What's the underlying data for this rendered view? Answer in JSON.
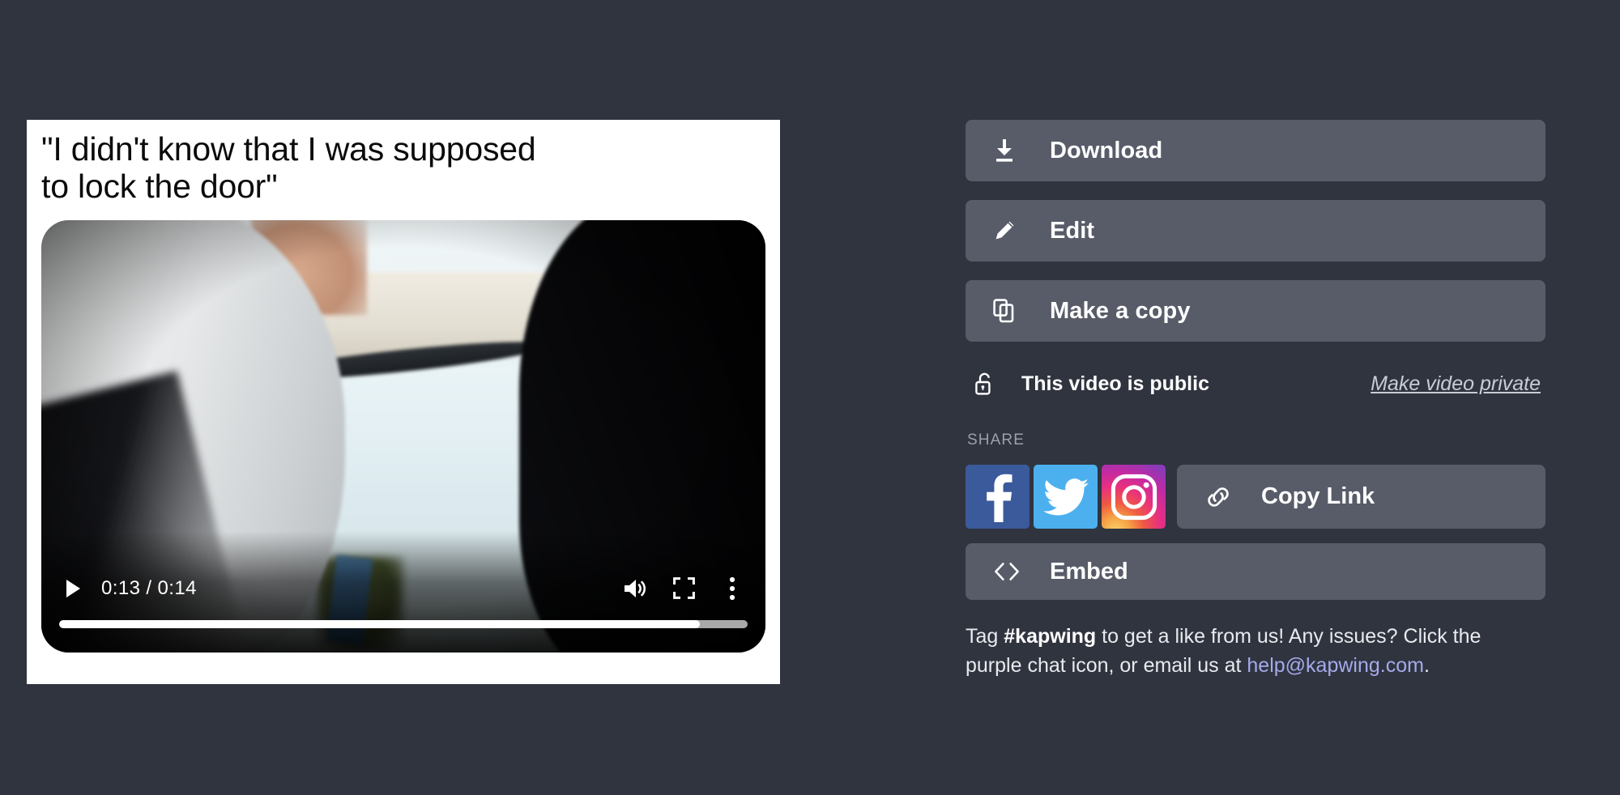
{
  "video": {
    "caption": "\"I didn't know that I was supposed\nto lock the door\"",
    "player": {
      "time_display": "0:13 / 0:14",
      "current_time": "0:13",
      "duration": "0:14",
      "progress_percent": 93,
      "state": "paused",
      "play_icon": "play-icon",
      "volume_icon": "volume-icon",
      "fullscreen_icon": "fullscreen-icon",
      "more_icon": "more-options-icon"
    }
  },
  "actions": [
    {
      "id": "download",
      "label": "Download",
      "icon": "download-icon"
    },
    {
      "id": "edit",
      "label": "Edit",
      "icon": "pencil-icon"
    },
    {
      "id": "make-a-copy",
      "label": "Make a copy",
      "icon": "copy-icon"
    }
  ],
  "privacy": {
    "icon": "unlocked-padlock-icon",
    "status_text": "This video is public",
    "toggle_link": "Make video private"
  },
  "share": {
    "label": "SHARE",
    "socials": [
      {
        "id": "facebook",
        "name": "facebook-icon",
        "color": "#3b5a9b"
      },
      {
        "id": "twitter",
        "name": "twitter-icon",
        "color": "#4cb0ef"
      },
      {
        "id": "instagram",
        "name": "instagram-icon",
        "color": "#e8307f"
      }
    ],
    "copy_link": {
      "label": "Copy Link",
      "icon": "link-icon"
    },
    "embed": {
      "label": "Embed",
      "icon": "code-brackets-icon"
    }
  },
  "footer": {
    "text_before": "Tag ",
    "hashtag": "#kapwing",
    "text_middle": " to get a like from us! Any issues? Click the purple chat icon, or email us at ",
    "email": "help@kapwing.com",
    "text_after": "."
  },
  "colors": {
    "page_background": "#30343f",
    "button_fill": "#585c69",
    "text_primary": "#ffffff",
    "text_muted": "#9aa0ad",
    "link_email": "#a4aaea",
    "card_background": "#ffffff"
  }
}
